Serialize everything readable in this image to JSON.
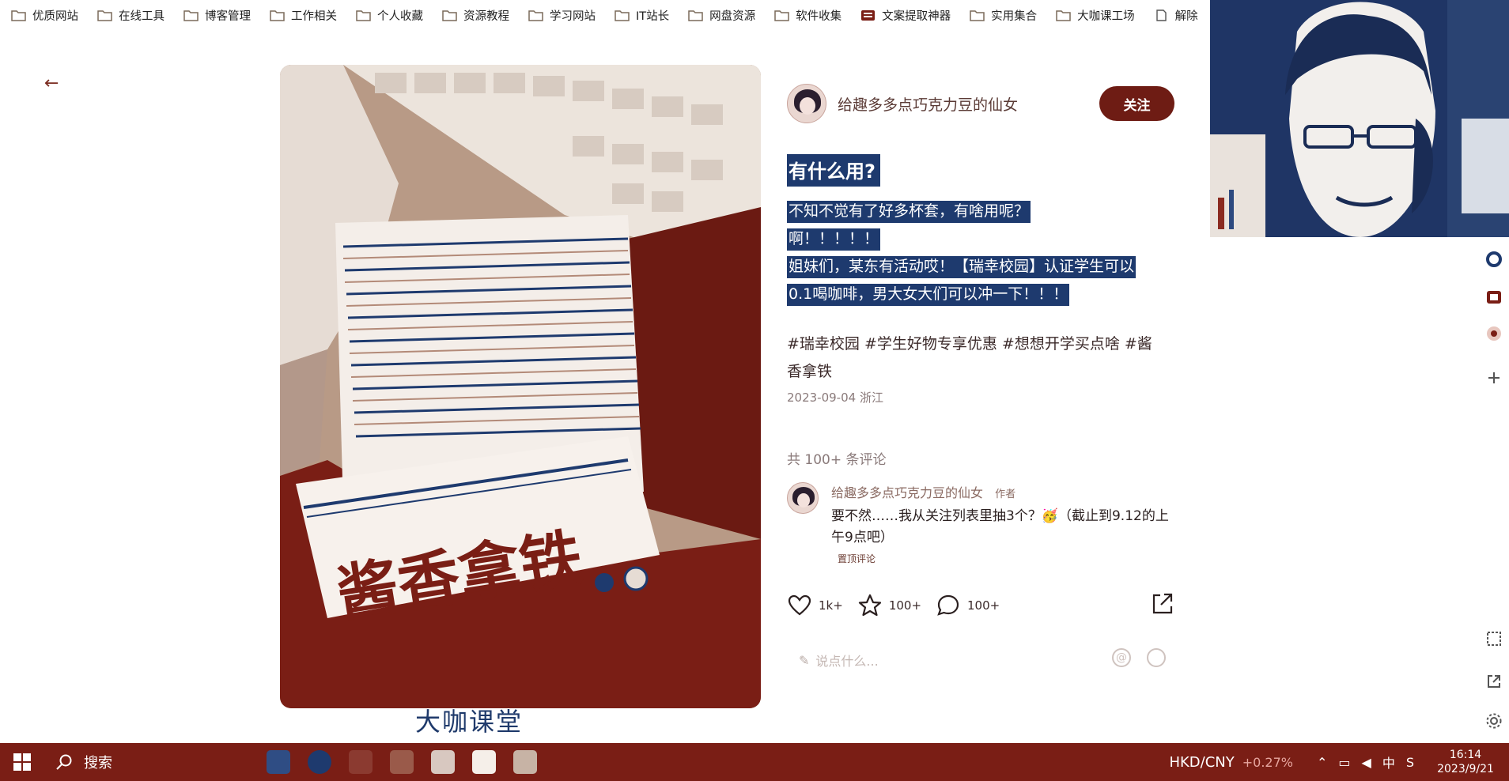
{
  "bookmarks": [
    {
      "label": "优质网站",
      "icon": "folder-icon"
    },
    {
      "label": "在线工具",
      "icon": "folder-icon"
    },
    {
      "label": "博客管理",
      "icon": "folder-icon"
    },
    {
      "label": "工作相关",
      "icon": "folder-icon"
    },
    {
      "label": "个人收藏",
      "icon": "folder-icon"
    },
    {
      "label": "资源教程",
      "icon": "folder-icon"
    },
    {
      "label": "学习网站",
      "icon": "folder-icon"
    },
    {
      "label": "IT站长",
      "icon": "folder-icon"
    },
    {
      "label": "网盘资源",
      "icon": "folder-icon"
    },
    {
      "label": "软件收集",
      "icon": "folder-icon"
    },
    {
      "label": "文案提取神器",
      "icon": "app-icon"
    },
    {
      "label": "实用集合",
      "icon": "folder-icon"
    },
    {
      "label": "大咖课工场",
      "icon": "folder-icon"
    },
    {
      "label": "解除",
      "icon": "page-icon"
    }
  ],
  "post": {
    "back_glyph": "←",
    "author": "给趣多多点巧克力豆的仙女",
    "follow_label": "关注",
    "title": "有什么用?",
    "body_lines": [
      "不知不觉有了好多杯套，有啥用呢？",
      "啊！！！！！",
      "姐妹们，某东有活动哎！【瑞幸校园】认证学生可以",
      "0.1喝咖啡，男大女大们可以冲一下！！！"
    ],
    "tags_line1": "#瑞幸校园 #学生好物专享优惠 #想想开学买点啥 #酱",
    "tags_line2": "香拿铁",
    "meta": "2023-09-04 浙江",
    "image_text": "酱香拿铁",
    "watermark": "大咖课堂"
  },
  "comments": {
    "count_label": "共 100+ 条评论",
    "items": [
      {
        "name": "给趣多多点巧克力豆的仙女",
        "tag": "作者",
        "text": "要不然……我从关注列表里抽3个？🥳（截止到9.12的上午9点吧）",
        "reply": "置顶评论"
      }
    ]
  },
  "actions": {
    "likes": "1k+",
    "stars": "100+",
    "comments": "100+"
  },
  "input": {
    "placeholder": "说点什么..."
  },
  "taskbar": {
    "search_label": "搜索",
    "fx_pair": "HKD/CNY",
    "fx_change": "+0.27%",
    "ime": "中",
    "time": "16:14",
    "date": "2023/9/21"
  }
}
